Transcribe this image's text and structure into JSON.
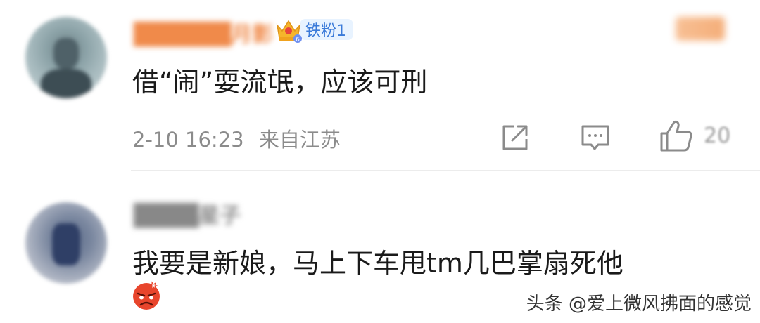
{
  "comments": [
    {
      "username": "██████月影",
      "fan_badge": "铁粉1",
      "text": "借“闹”耍流氓，应该可刑",
      "date": "2-10 16:23",
      "location": "来自江苏",
      "likes": "20"
    },
    {
      "username": "████星子",
      "text": "我要是新娘，马上下车甩tm几巴掌扇死他"
    }
  ],
  "watermark": "头条 @爱上微风拂面的感觉",
  "colors": {
    "fan_badge_bg": "#e8f3ff",
    "fan_badge_text": "#3a7ad9",
    "meta_text": "#8b8b8b",
    "comment_text": "#1a1a1a"
  },
  "icons": [
    "crown-icon",
    "share-icon",
    "reply-icon",
    "like-icon",
    "angry-emoji-icon"
  ]
}
